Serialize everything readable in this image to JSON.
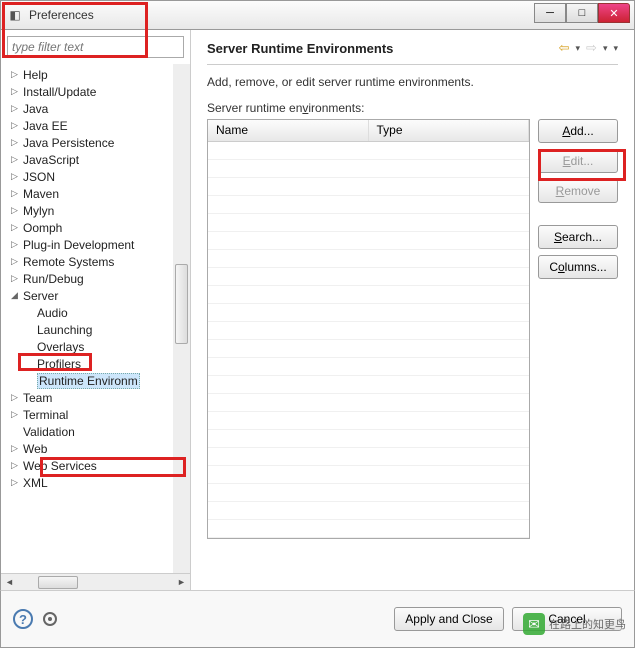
{
  "titlebar": {
    "title": "Preferences"
  },
  "filter": {
    "placeholder": "type filter text"
  },
  "tree": {
    "items": [
      {
        "label": "Help",
        "expandable": true,
        "expanded": false
      },
      {
        "label": "Install/Update",
        "expandable": true,
        "expanded": false
      },
      {
        "label": "Java",
        "expandable": true,
        "expanded": false
      },
      {
        "label": "Java EE",
        "expandable": true,
        "expanded": false
      },
      {
        "label": "Java Persistence",
        "expandable": true,
        "expanded": false
      },
      {
        "label": "JavaScript",
        "expandable": true,
        "expanded": false
      },
      {
        "label": "JSON",
        "expandable": true,
        "expanded": false
      },
      {
        "label": "Maven",
        "expandable": true,
        "expanded": false
      },
      {
        "label": "Mylyn",
        "expandable": true,
        "expanded": false
      },
      {
        "label": "Oomph",
        "expandable": true,
        "expanded": false
      },
      {
        "label": "Plug-in Development",
        "expandable": true,
        "expanded": false
      },
      {
        "label": "Remote Systems",
        "expandable": true,
        "expanded": false
      },
      {
        "label": "Run/Debug",
        "expandable": true,
        "expanded": false
      },
      {
        "label": "Server",
        "expandable": true,
        "expanded": true,
        "children": [
          {
            "label": "Audio"
          },
          {
            "label": "Launching"
          },
          {
            "label": "Overlays"
          },
          {
            "label": "Profilers"
          },
          {
            "label": "Runtime Environm",
            "selected": true
          }
        ]
      },
      {
        "label": "Team",
        "expandable": true,
        "expanded": false
      },
      {
        "label": "Terminal",
        "expandable": true,
        "expanded": false
      },
      {
        "label": "Validation",
        "expandable": false
      },
      {
        "label": "Web",
        "expandable": true,
        "expanded": false
      },
      {
        "label": "Web Services",
        "expandable": true,
        "expanded": false
      },
      {
        "label": "XML",
        "expandable": true,
        "expanded": false
      }
    ]
  },
  "panel": {
    "title": "Server Runtime Environments",
    "description": "Add, remove, or edit server runtime environments.",
    "subheading": "Server runtime environments:",
    "columns": {
      "name": "Name",
      "type": "Type"
    },
    "buttons": {
      "add": "Add...",
      "edit": "Edit...",
      "remove": "Remove",
      "search": "Search...",
      "columns": "Columns..."
    }
  },
  "bottom": {
    "apply_close": "Apply and Close",
    "cancel": "Cancel"
  },
  "watermark": "在路上的知更鸟"
}
